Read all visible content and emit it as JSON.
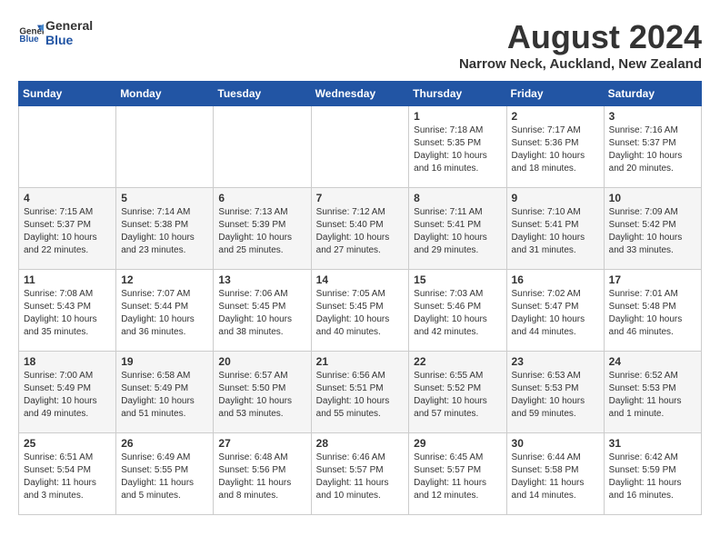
{
  "header": {
    "logo_general": "General",
    "logo_blue": "Blue",
    "month_year": "August 2024",
    "location": "Narrow Neck, Auckland, New Zealand"
  },
  "days_of_week": [
    "Sunday",
    "Monday",
    "Tuesday",
    "Wednesday",
    "Thursday",
    "Friday",
    "Saturday"
  ],
  "weeks": [
    [
      {
        "day": "",
        "info": ""
      },
      {
        "day": "",
        "info": ""
      },
      {
        "day": "",
        "info": ""
      },
      {
        "day": "",
        "info": ""
      },
      {
        "day": "1",
        "info": "Sunrise: 7:18 AM\nSunset: 5:35 PM\nDaylight: 10 hours\nand 16 minutes."
      },
      {
        "day": "2",
        "info": "Sunrise: 7:17 AM\nSunset: 5:36 PM\nDaylight: 10 hours\nand 18 minutes."
      },
      {
        "day": "3",
        "info": "Sunrise: 7:16 AM\nSunset: 5:37 PM\nDaylight: 10 hours\nand 20 minutes."
      }
    ],
    [
      {
        "day": "4",
        "info": "Sunrise: 7:15 AM\nSunset: 5:37 PM\nDaylight: 10 hours\nand 22 minutes."
      },
      {
        "day": "5",
        "info": "Sunrise: 7:14 AM\nSunset: 5:38 PM\nDaylight: 10 hours\nand 23 minutes."
      },
      {
        "day": "6",
        "info": "Sunrise: 7:13 AM\nSunset: 5:39 PM\nDaylight: 10 hours\nand 25 minutes."
      },
      {
        "day": "7",
        "info": "Sunrise: 7:12 AM\nSunset: 5:40 PM\nDaylight: 10 hours\nand 27 minutes."
      },
      {
        "day": "8",
        "info": "Sunrise: 7:11 AM\nSunset: 5:41 PM\nDaylight: 10 hours\nand 29 minutes."
      },
      {
        "day": "9",
        "info": "Sunrise: 7:10 AM\nSunset: 5:41 PM\nDaylight: 10 hours\nand 31 minutes."
      },
      {
        "day": "10",
        "info": "Sunrise: 7:09 AM\nSunset: 5:42 PM\nDaylight: 10 hours\nand 33 minutes."
      }
    ],
    [
      {
        "day": "11",
        "info": "Sunrise: 7:08 AM\nSunset: 5:43 PM\nDaylight: 10 hours\nand 35 minutes."
      },
      {
        "day": "12",
        "info": "Sunrise: 7:07 AM\nSunset: 5:44 PM\nDaylight: 10 hours\nand 36 minutes."
      },
      {
        "day": "13",
        "info": "Sunrise: 7:06 AM\nSunset: 5:45 PM\nDaylight: 10 hours\nand 38 minutes."
      },
      {
        "day": "14",
        "info": "Sunrise: 7:05 AM\nSunset: 5:45 PM\nDaylight: 10 hours\nand 40 minutes."
      },
      {
        "day": "15",
        "info": "Sunrise: 7:03 AM\nSunset: 5:46 PM\nDaylight: 10 hours\nand 42 minutes."
      },
      {
        "day": "16",
        "info": "Sunrise: 7:02 AM\nSunset: 5:47 PM\nDaylight: 10 hours\nand 44 minutes."
      },
      {
        "day": "17",
        "info": "Sunrise: 7:01 AM\nSunset: 5:48 PM\nDaylight: 10 hours\nand 46 minutes."
      }
    ],
    [
      {
        "day": "18",
        "info": "Sunrise: 7:00 AM\nSunset: 5:49 PM\nDaylight: 10 hours\nand 49 minutes."
      },
      {
        "day": "19",
        "info": "Sunrise: 6:58 AM\nSunset: 5:49 PM\nDaylight: 10 hours\nand 51 minutes."
      },
      {
        "day": "20",
        "info": "Sunrise: 6:57 AM\nSunset: 5:50 PM\nDaylight: 10 hours\nand 53 minutes."
      },
      {
        "day": "21",
        "info": "Sunrise: 6:56 AM\nSunset: 5:51 PM\nDaylight: 10 hours\nand 55 minutes."
      },
      {
        "day": "22",
        "info": "Sunrise: 6:55 AM\nSunset: 5:52 PM\nDaylight: 10 hours\nand 57 minutes."
      },
      {
        "day": "23",
        "info": "Sunrise: 6:53 AM\nSunset: 5:53 PM\nDaylight: 10 hours\nand 59 minutes."
      },
      {
        "day": "24",
        "info": "Sunrise: 6:52 AM\nSunset: 5:53 PM\nDaylight: 11 hours\nand 1 minute."
      }
    ],
    [
      {
        "day": "25",
        "info": "Sunrise: 6:51 AM\nSunset: 5:54 PM\nDaylight: 11 hours\nand 3 minutes."
      },
      {
        "day": "26",
        "info": "Sunrise: 6:49 AM\nSunset: 5:55 PM\nDaylight: 11 hours\nand 5 minutes."
      },
      {
        "day": "27",
        "info": "Sunrise: 6:48 AM\nSunset: 5:56 PM\nDaylight: 11 hours\nand 8 minutes."
      },
      {
        "day": "28",
        "info": "Sunrise: 6:46 AM\nSunset: 5:57 PM\nDaylight: 11 hours\nand 10 minutes."
      },
      {
        "day": "29",
        "info": "Sunrise: 6:45 AM\nSunset: 5:57 PM\nDaylight: 11 hours\nand 12 minutes."
      },
      {
        "day": "30",
        "info": "Sunrise: 6:44 AM\nSunset: 5:58 PM\nDaylight: 11 hours\nand 14 minutes."
      },
      {
        "day": "31",
        "info": "Sunrise: 6:42 AM\nSunset: 5:59 PM\nDaylight: 11 hours\nand 16 minutes."
      }
    ]
  ]
}
